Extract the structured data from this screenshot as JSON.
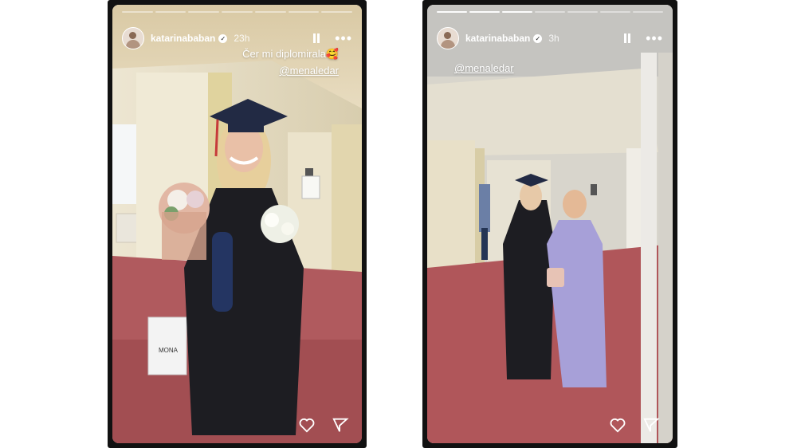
{
  "stories": [
    {
      "username": "katarinababan",
      "time": "23h",
      "caption": "Čer mi diplomirala🥰",
      "mention": "@menaledar",
      "bag_text": "MONA",
      "progress": {
        "total_segments": 7,
        "completed": 0
      }
    },
    {
      "username": "katarinababan",
      "time": "3h",
      "mention": "@menaledar",
      "progress": {
        "total_segments": 7,
        "completed": 3
      }
    }
  ],
  "icons": [
    "verified-icon",
    "pause-icon",
    "more-icon",
    "heart-icon",
    "send-icon"
  ]
}
